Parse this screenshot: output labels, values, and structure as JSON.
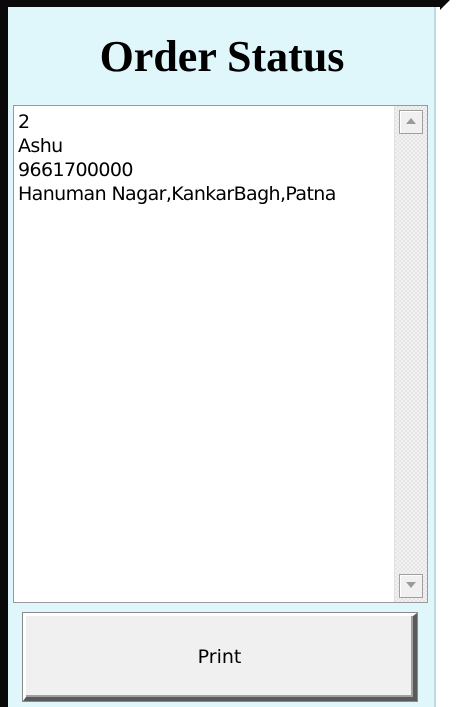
{
  "window": {
    "title": "Order Status"
  },
  "details_box": {
    "lines": [
      "2",
      "Ashu",
      "9661700000",
      "Hanuman Nagar,KankarBagh,Patna"
    ]
  },
  "actions": {
    "print_label": "Print"
  },
  "colors": {
    "panel_background": "#dff6fb",
    "frame": "#0a0a0a",
    "button_face": "#f0f0f0"
  },
  "icons": {
    "scroll_up": "scroll-up-arrow-icon",
    "scroll_down": "scroll-down-arrow-icon"
  }
}
